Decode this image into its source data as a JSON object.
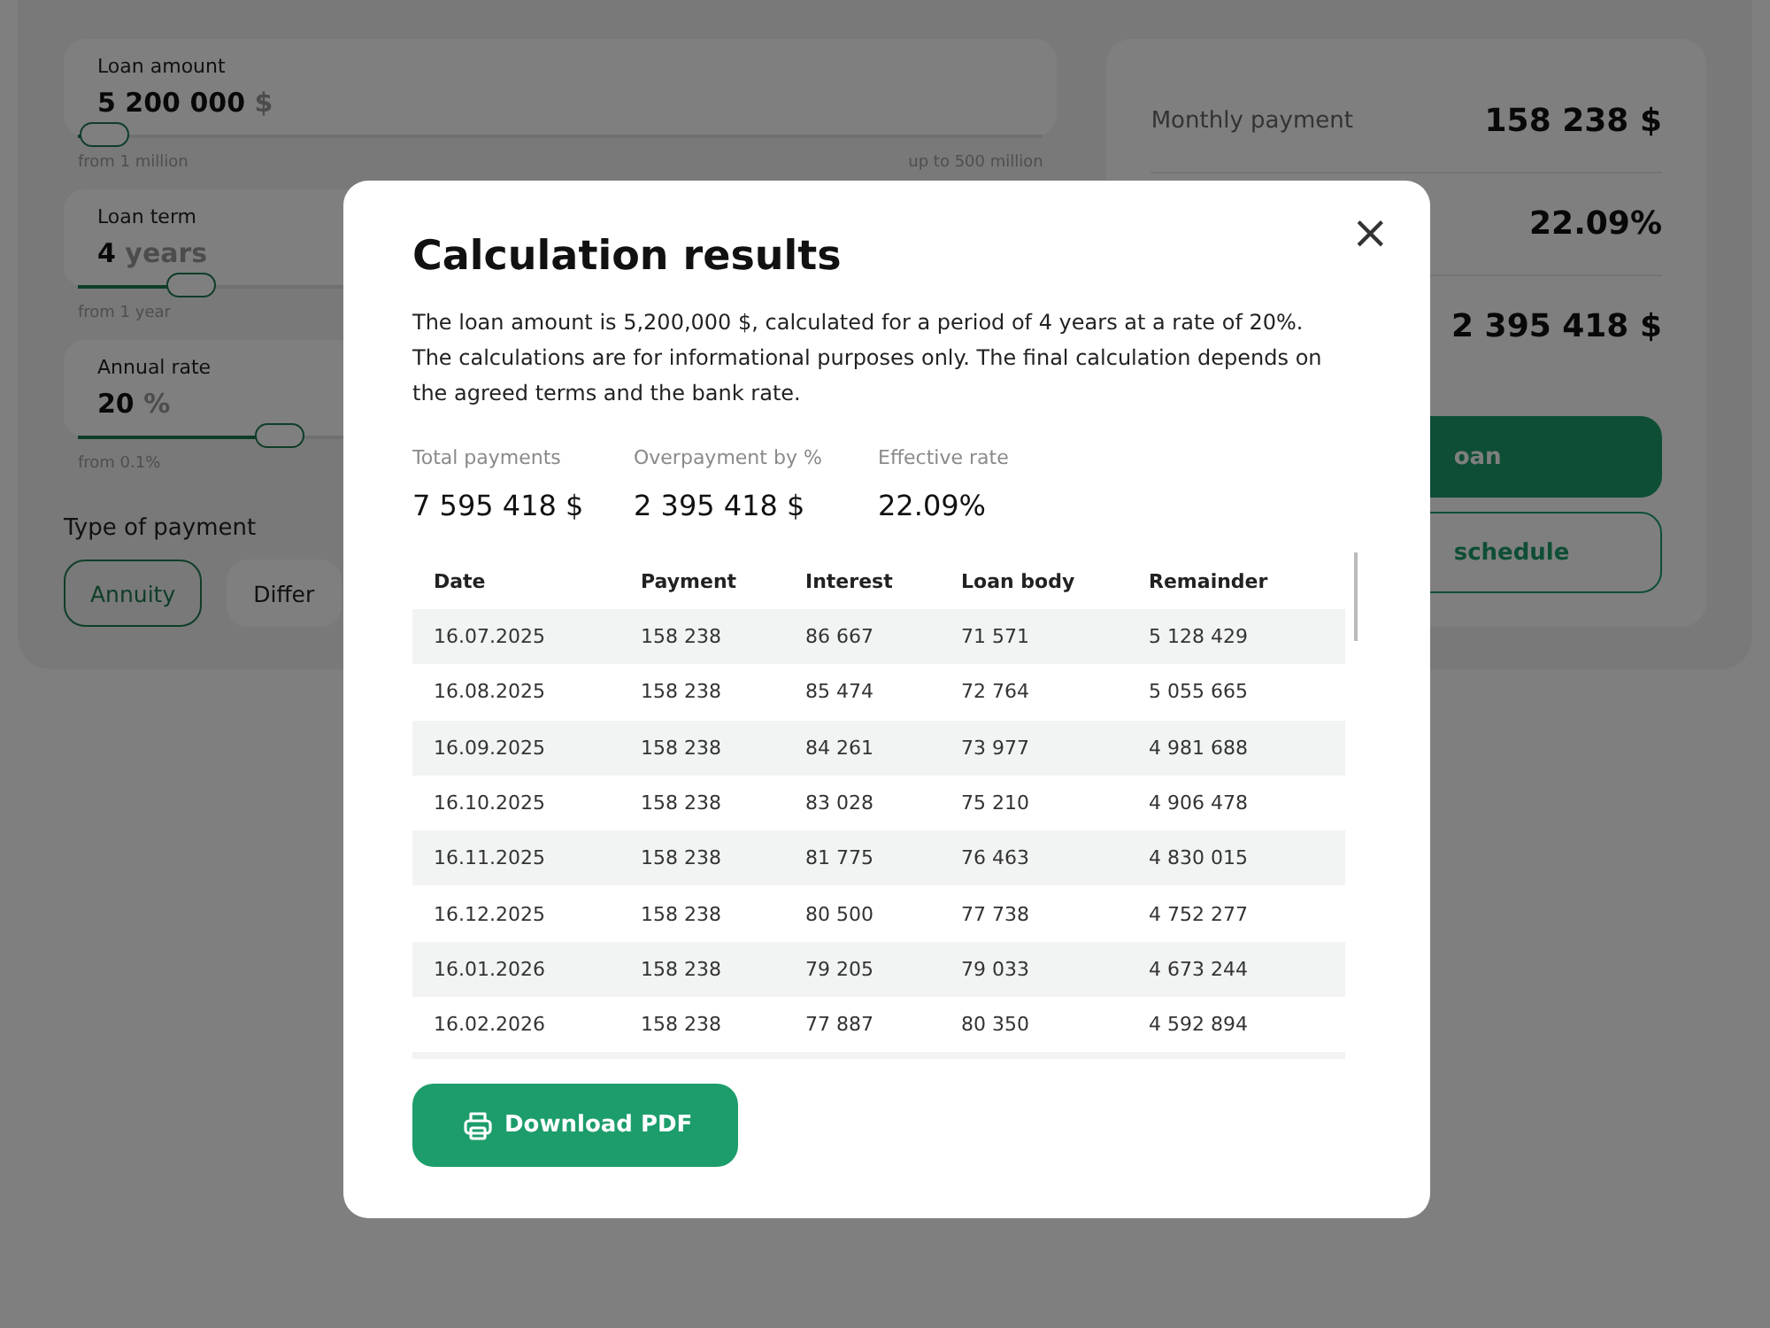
{
  "calculator": {
    "sliders": [
      {
        "label": "Loan amount",
        "value": "5 200 000",
        "unit": "$",
        "level": 0.03,
        "min_label": "from 1 million",
        "max_label": "up to 500 million"
      },
      {
        "label": "Loan term",
        "value": "4",
        "unit": "years",
        "level": 0.12,
        "min_label": "from 1 year"
      },
      {
        "label": "Annual rate",
        "value": "20",
        "unit": "%",
        "level": 0.21,
        "min_label": "from 0.1%"
      }
    ],
    "payment_type": {
      "label": "Type of payment",
      "options": [
        {
          "label": "Annuity",
          "selected": true
        },
        {
          "label": "Differ",
          "selected": false
        }
      ]
    }
  },
  "summary": {
    "rows": [
      {
        "label": "Monthly payment",
        "value": "158 238 $"
      },
      {
        "value": "22.09%"
      },
      {
        "value": "2 395 418 $"
      }
    ],
    "buttons": [
      {
        "kind": "primary",
        "label": "oan"
      },
      {
        "kind": "outline",
        "label": "schedule"
      }
    ]
  },
  "modal": {
    "title": "Calculation results",
    "close": "×",
    "description": "The loan amount is 5,200,000 $, calculated for a period of 4 years at a rate of 20%. The calculations are for informational purposes only. The final calculation depends on the agreed terms and the bank rate.",
    "stats": [
      {
        "label": "Total payments",
        "value": "7 595 418 $"
      },
      {
        "label": "Overpayment by %",
        "value": "2 395 418 $"
      },
      {
        "label": "Effective rate",
        "value": "22.09%"
      }
    ],
    "table": {
      "columns": [
        "Date",
        "Payment",
        "Interest",
        "Loan body",
        "Remainder"
      ],
      "rows": [
        [
          "16.07.2025",
          "158 238",
          "86 667",
          "71 571",
          "5 128 429"
        ],
        [
          "16.08.2025",
          "158 238",
          "85 474",
          "72 764",
          "5 055 665"
        ],
        [
          "16.09.2025",
          "158 238",
          "84 261",
          "73 977",
          "4 981 688"
        ],
        [
          "16.10.2025",
          "158 238",
          "83 028",
          "75 210",
          "4 906 478"
        ],
        [
          "16.11.2025",
          "158 238",
          "81 775",
          "76 463",
          "4 830 015"
        ],
        [
          "16.12.2025",
          "158 238",
          "80 500",
          "77 738",
          "4 752 277"
        ],
        [
          "16.01.2026",
          "158 238",
          "79 205",
          "79 033",
          "4 673 244"
        ],
        [
          "16.02.2026",
          "158 238",
          "77 887",
          "80 350",
          "4 592 894"
        ]
      ]
    },
    "download_button": "Download PDF"
  }
}
